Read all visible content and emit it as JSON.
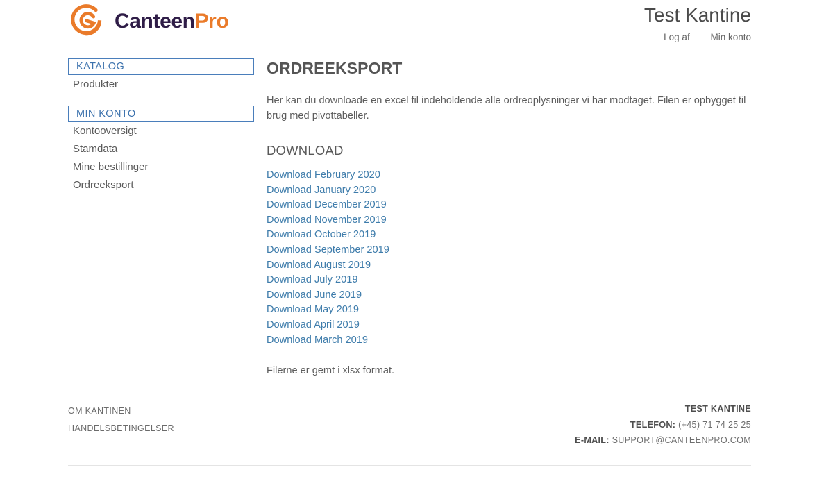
{
  "brand": {
    "name_part1": "Canteen",
    "name_part2": "Pro",
    "logo_icon": "canteenpro-spiral-e-logo",
    "colors": {
      "dark": "#2f1d47",
      "orange": "#ea7b2a"
    }
  },
  "header": {
    "customer": "Test Kantine",
    "links": [
      {
        "label": "Log af"
      },
      {
        "label": "Min konto"
      }
    ]
  },
  "sidebar": {
    "blocks": [
      {
        "title": "KATALOG",
        "items": [
          {
            "label": "Produkter"
          }
        ]
      },
      {
        "title": "MIN KONTO",
        "items": [
          {
            "label": "Kontooversigt"
          },
          {
            "label": "Stamdata"
          },
          {
            "label": "Mine bestillinger"
          },
          {
            "label": "Ordreeksport"
          }
        ]
      }
    ]
  },
  "main": {
    "title": "ORDREEKSPORT",
    "intro": "Her kan du downloade en excel fil indeholdende alle ordreoplysninger vi har modtaget. Filen er opbygget til brug med pivottabeller.",
    "section_title": "DOWNLOAD",
    "downloads": [
      {
        "label": "Download February 2020"
      },
      {
        "label": "Download January 2020"
      },
      {
        "label": "Download December 2019"
      },
      {
        "label": "Download November 2019"
      },
      {
        "label": "Download October 2019"
      },
      {
        "label": "Download September 2019"
      },
      {
        "label": "Download August 2019"
      },
      {
        "label": "Download July 2019"
      },
      {
        "label": "Download June 2019"
      },
      {
        "label": "Download May 2019"
      },
      {
        "label": "Download April 2019"
      },
      {
        "label": "Download March 2019"
      }
    ],
    "note": "Filerne er gemt i xlsx format.",
    "link_color": "#3e7cab"
  },
  "footer": {
    "links": [
      {
        "label": "OM KANTINEN"
      },
      {
        "label": "HANDELSBETINGELSER"
      }
    ],
    "company": "TEST KANTINE",
    "phone_label": "TELEFON:",
    "phone_value": "(+45) 71 74 25 25",
    "email_label": "E-MAIL:",
    "email_value": "SUPPORT@CANTEENPRO.COM"
  }
}
